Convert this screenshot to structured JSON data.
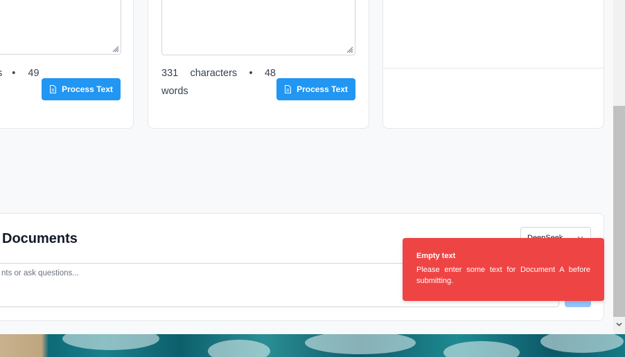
{
  "doc_left": {
    "stats_chars": "s",
    "stats_sep": "•",
    "stats_words_num": "49",
    "process_label": "Process Text"
  },
  "doc_middle": {
    "stats_chars_num": "331",
    "stats_chars_label": "characters",
    "stats_sep": "•",
    "stats_words_num": "48",
    "stats_words_label": "words",
    "process_label": "Process Text"
  },
  "compare": {
    "title": "Documents",
    "input_placeholder": "nts or ask questions...",
    "model_select_value": "DeepSeek"
  },
  "toast": {
    "title": "Empty text",
    "message": "Please enter some text for Document A before submitting.",
    "color": "#ef4444"
  },
  "colors": {
    "accent": "#2196f3",
    "error": "#ef4444"
  }
}
